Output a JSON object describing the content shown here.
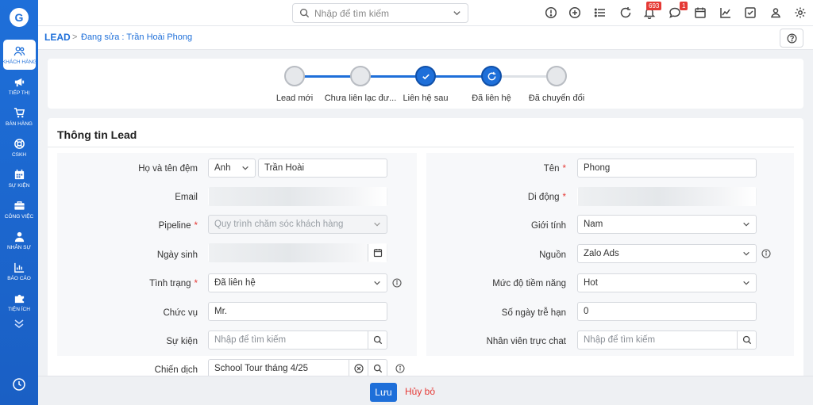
{
  "topbar": {
    "search_placeholder": "Nhập để tìm kiếm",
    "notifications_count": "693",
    "messages_count": "1"
  },
  "sidebar": {
    "items": [
      {
        "label": "Khách hàng",
        "icon": "users-icon"
      },
      {
        "label": "Tiếp thị",
        "icon": "megaphone-icon"
      },
      {
        "label": "Bán hàng",
        "icon": "cart-icon"
      },
      {
        "label": "CSKH",
        "icon": "lifebuoy-icon"
      },
      {
        "label": "Sự kiện",
        "icon": "calendar-icon"
      },
      {
        "label": "Công việc",
        "icon": "briefcase-icon"
      },
      {
        "label": "Nhân sự",
        "icon": "person-icon"
      },
      {
        "label": "Báo cáo",
        "icon": "chart-icon"
      },
      {
        "label": "Tiện ích",
        "icon": "puzzle-icon"
      }
    ]
  },
  "breadcrumb": {
    "root": "LEAD",
    "separator": ">",
    "current": "Đang sửa : Trần Hoài Phong"
  },
  "stepper": {
    "steps": [
      {
        "label": "Lead mới",
        "state": "pending"
      },
      {
        "label": "Chưa liên lạc đư...",
        "state": "pending"
      },
      {
        "label": "Liên hệ sau",
        "state": "done"
      },
      {
        "label": "Đã liên hệ",
        "state": "current"
      },
      {
        "label": "Đã chuyển đổi",
        "state": "pending"
      }
    ]
  },
  "form": {
    "title": "Thông tin Lead",
    "required_mark": "*",
    "left": {
      "full_name": {
        "label": "Họ và tên đệm",
        "salutation": "Anh",
        "value": "Trần Hoài"
      },
      "email": {
        "label": "Email",
        "value": ""
      },
      "pipeline": {
        "label": "Pipeline",
        "value": "Quy trình chăm sóc khách hàng"
      },
      "birthday": {
        "label": "Ngày sinh",
        "value": ""
      },
      "status": {
        "label": "Tình trạng",
        "value": "Đã liên hệ"
      },
      "position": {
        "label": "Chức vụ",
        "value": "Mr."
      },
      "event": {
        "label": "Sự kiện",
        "placeholder": "Nhập để tìm kiếm"
      },
      "campaign": {
        "label": "Chiến dịch",
        "value": "School Tour tháng 4/25"
      }
    },
    "right": {
      "first_name": {
        "label": "Tên",
        "value": "Phong"
      },
      "mobile": {
        "label": "Di động",
        "value": ""
      },
      "gender": {
        "label": "Giới tính",
        "value": "Nam"
      },
      "source": {
        "label": "Nguồn",
        "value": "Zalo Ads"
      },
      "potential": {
        "label": "Mức độ tiềm năng",
        "value": "Hot"
      },
      "overdue_days": {
        "label": "Số ngày trễ hạn",
        "value": "0"
      },
      "chat_staff": {
        "label": "Nhân viên trực chat",
        "placeholder": "Nhập để tìm kiếm"
      }
    }
  },
  "footer": {
    "save_label": "Lưu",
    "cancel_label": "Hủy bỏ"
  },
  "colors": {
    "primary": "#1e6fd9",
    "danger": "#e53935"
  }
}
